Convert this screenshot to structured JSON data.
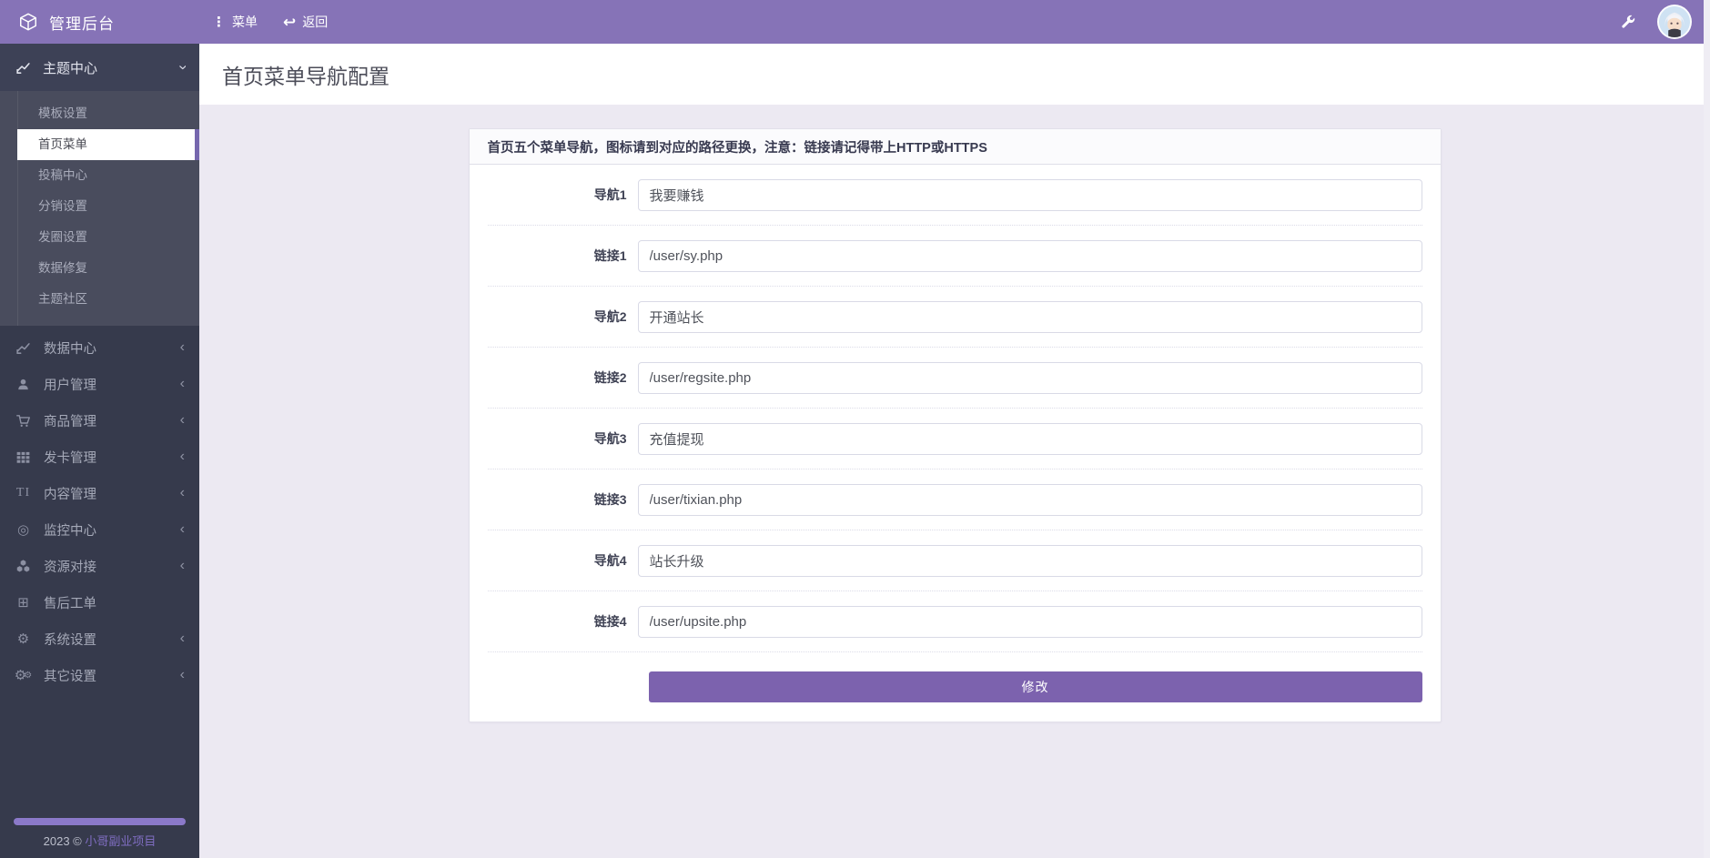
{
  "topbar": {
    "brand": "管理后台",
    "menu_label": "菜单",
    "back_label": "返回"
  },
  "icons": {
    "menu_dots": "⋮",
    "back_arrow": "↩",
    "chevron_down": "‹",
    "chevron_left": "‹",
    "target": "◎",
    "plus_square": "⊞",
    "gear": "⚙",
    "text_tool": "TI"
  },
  "sidebar": {
    "theme": {
      "label": "主题中心",
      "expanded": true,
      "children": [
        {
          "label": "模板设置",
          "active": false
        },
        {
          "label": "首页菜单",
          "active": true
        },
        {
          "label": "投稿中心",
          "active": false
        },
        {
          "label": "分销设置",
          "active": false
        },
        {
          "label": "发圈设置",
          "active": false
        },
        {
          "label": "数据修复",
          "active": false
        },
        {
          "label": "主题社区",
          "active": false
        }
      ]
    },
    "items": [
      {
        "icon": "chart-line",
        "label": "数据中心",
        "arrow": "‹"
      },
      {
        "icon": "user",
        "label": "用户管理",
        "arrow": "‹"
      },
      {
        "icon": "cart",
        "label": "商品管理",
        "arrow": "‹"
      },
      {
        "icon": "grid",
        "label": "发卡管理",
        "arrow": "‹"
      },
      {
        "icon": "text",
        "label": "内容管理",
        "arrow": "‹"
      },
      {
        "icon": "target",
        "label": "监控中心",
        "arrow": "‹"
      },
      {
        "icon": "cubes",
        "label": "资源对接",
        "arrow": "‹"
      },
      {
        "icon": "plus-square",
        "label": "售后工单",
        "arrow": ""
      },
      {
        "icon": "gear",
        "label": "系统设置",
        "arrow": "‹"
      },
      {
        "icon": "gears",
        "label": "其它设置",
        "arrow": "‹"
      }
    ],
    "footer_year": "2023 © ",
    "footer_brand": "小哥副业项目"
  },
  "page": {
    "title": "首页菜单导航配置"
  },
  "panel": {
    "header": "首页五个菜单导航，图标请到对应的路径更换，注意：链接请记得带上HTTP或HTTPS",
    "fields": [
      {
        "label": "导航1",
        "value": "我要赚钱"
      },
      {
        "label": "链接1",
        "value": "/user/sy.php"
      },
      {
        "label": "导航2",
        "value": "开通站长"
      },
      {
        "label": "链接2",
        "value": "/user/regsite.php"
      },
      {
        "label": "导航3",
        "value": "充值提现"
      },
      {
        "label": "链接3",
        "value": "/user/tixian.php"
      },
      {
        "label": "导航4",
        "value": "站长升级"
      },
      {
        "label": "链接4",
        "value": "/user/upsite.php"
      }
    ],
    "submit_label": "修改"
  },
  "colors": {
    "topbar": "#8673B7",
    "sidebar_bg": "#363A4C",
    "submenu_bg": "#494C5D",
    "active_border": "#7667AE",
    "content_bg": "#ECE9F2",
    "button": "#7C62AE",
    "footer_bar": "#8B79C9"
  }
}
